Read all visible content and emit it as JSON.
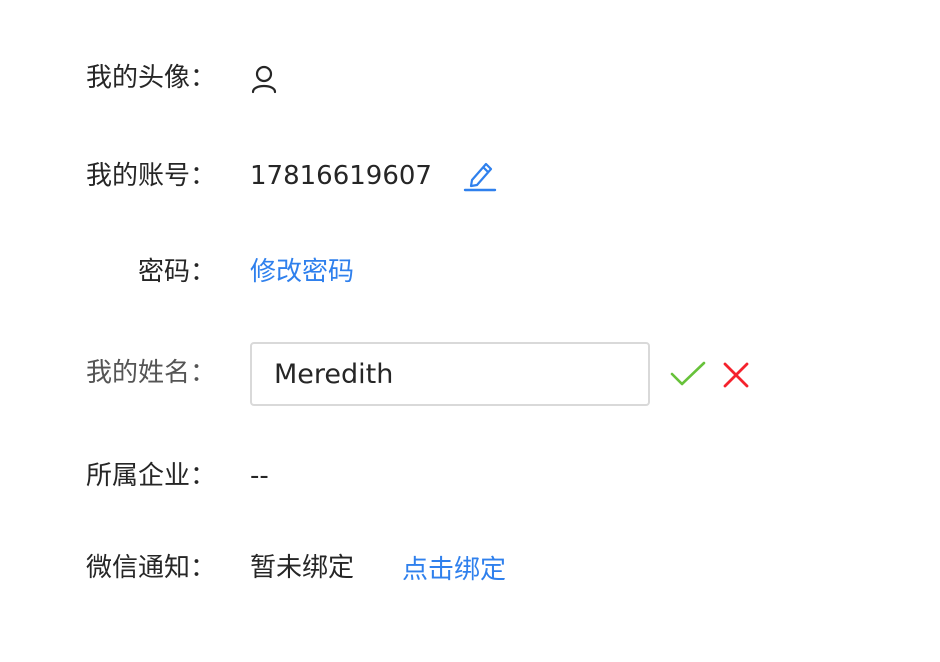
{
  "profile": {
    "avatar": {
      "label": "我的头像：",
      "icon": "user-icon"
    },
    "account": {
      "label": "我的账号：",
      "value": "17816619607",
      "edit_icon": "pencil-edit-icon",
      "accent": "#2f80ed"
    },
    "password": {
      "label": "密码：",
      "link_text": "修改密码"
    },
    "name": {
      "label": "我的姓名：",
      "input_value": "Meredith",
      "confirm_icon": "check-icon",
      "confirm_color": "#67c23a",
      "cancel_icon": "close-icon",
      "cancel_color": "#f5222d"
    },
    "company": {
      "label": "所属企业：",
      "value": "--"
    },
    "wechat": {
      "label": "微信通知：",
      "status": "暂未绑定",
      "link_text": "点击绑定"
    }
  }
}
